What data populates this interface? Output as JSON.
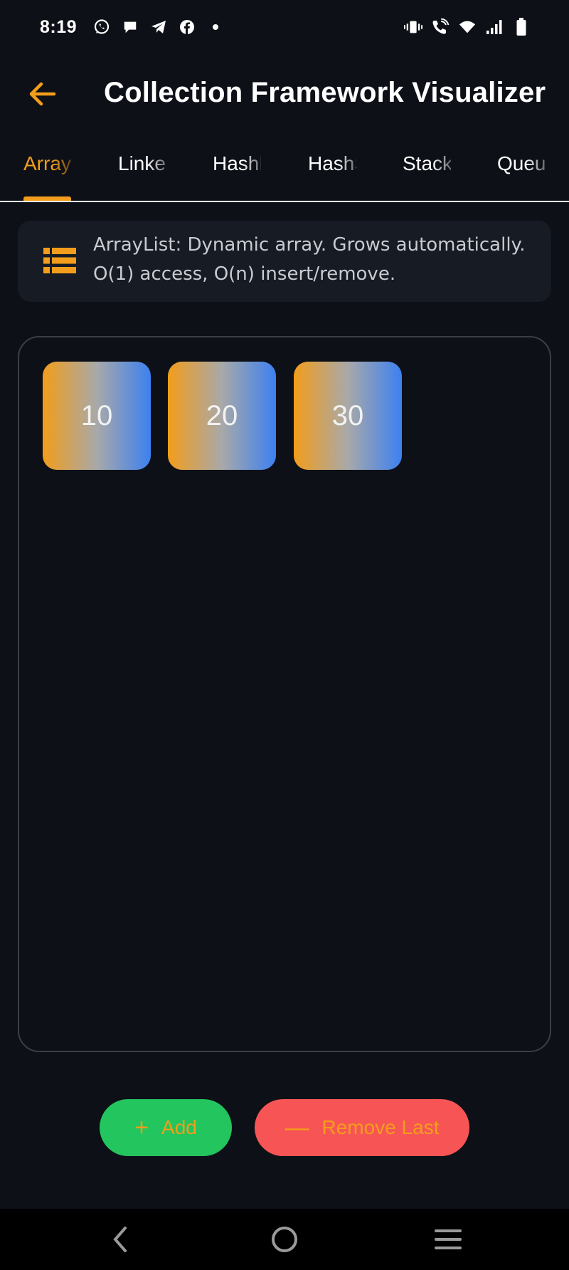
{
  "status_bar": {
    "time": "8:19",
    "notification_icons": [
      "whatsapp-icon",
      "chat-bubble-icon",
      "telegram-icon",
      "facebook-icon",
      "dot-icon"
    ],
    "system_icons": [
      "vibrate-icon",
      "wifi-calling-icon",
      "wifi-icon",
      "signal-icon",
      "battery-icon"
    ]
  },
  "app_bar": {
    "title": "Collection Framework Visualizer",
    "back_icon": "arrow-left-icon"
  },
  "tabs": [
    {
      "label": "ArrayList",
      "active": true
    },
    {
      "label": "LinkedList",
      "active": false
    },
    {
      "label": "HashMap",
      "active": false
    },
    {
      "label": "HashSet",
      "active": false
    },
    {
      "label": "Stack",
      "active": false
    },
    {
      "label": "Queue",
      "active": false
    }
  ],
  "info": {
    "icon": "list-icon",
    "line1": "ArrayList: Dynamic array. Grows automatically.",
    "line2": "O(1) access, O(n) insert/remove."
  },
  "elements": [
    "10",
    "20",
    "30"
  ],
  "actions": {
    "add_label": "Add",
    "add_icon": "+",
    "remove_label": "Remove Last",
    "remove_icon": "—"
  },
  "colors": {
    "accent": "#f29d1b",
    "background": "#0d1017",
    "add_button": "#22c55e",
    "remove_button": "#f75555",
    "gradient_end": "#3d80f0"
  }
}
